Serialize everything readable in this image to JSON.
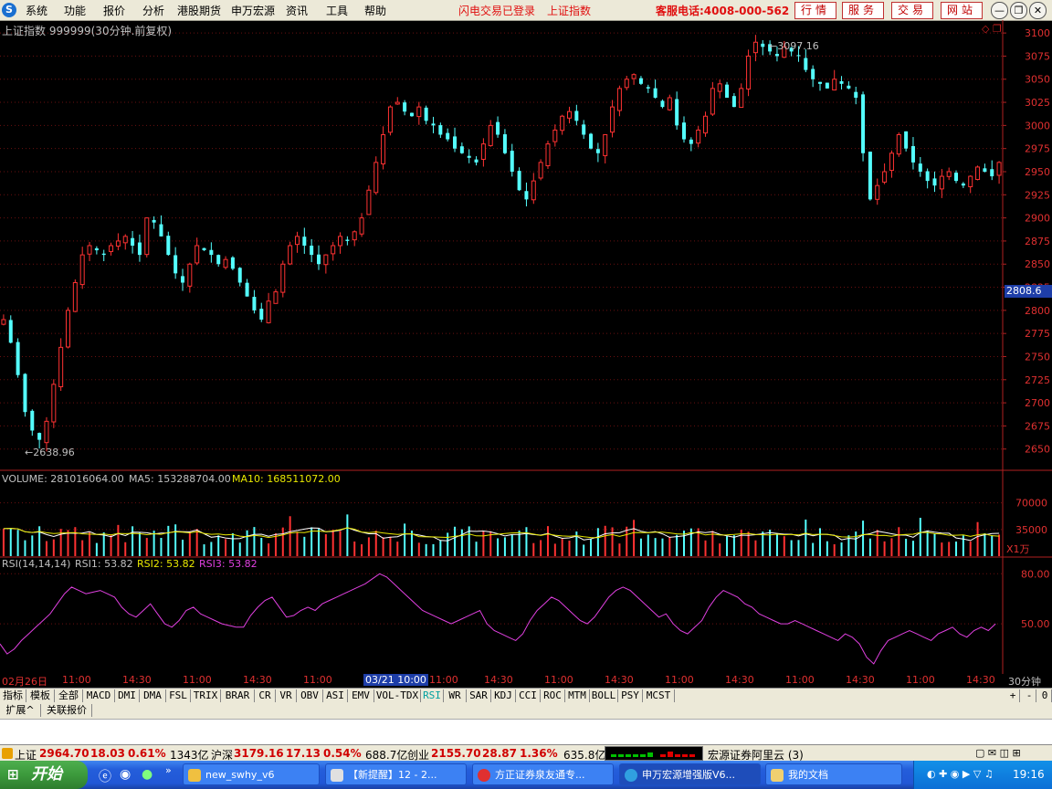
{
  "menubar": {
    "items": [
      "系统",
      "功能",
      "报价",
      "分析",
      "港股期货",
      "申万宏源",
      "资讯",
      "工具",
      "帮助"
    ],
    "login_status": "闪电交易已登录",
    "current_index": "上证指数",
    "hotline": "客服电话:4008-000-562",
    "service_buttons": [
      "行情",
      "服务",
      "交易",
      "网站"
    ],
    "window_controls": [
      "minimize",
      "restore",
      "close"
    ]
  },
  "chart_header": {
    "title": "上证指数 999999(30分钟.前复权)",
    "volume_label": "VOLUME: 281016064.00",
    "ma5_label": "MA5: 153288704.00",
    "ma10_label": "MA10: 168511072.00",
    "rsi_label": "RSI(14,14,14)",
    "rsi1_label": "RSI1: 53.82",
    "rsi2_label": "RSI2: 53.82",
    "rsi3_label": "RSI3: 53.82",
    "high_marker": "3097.16",
    "low_marker": "2638.96",
    "current_price_tag": "2808.6",
    "volume_unit": "X1万"
  },
  "chart_data": {
    "type": "candlestick",
    "price_axis_ticks": [
      "3100",
      "3075",
      "3050",
      "3025",
      "3000",
      "2975",
      "2950",
      "2925",
      "2900",
      "2875",
      "2850",
      "2825",
      "2800",
      "2775",
      "2750",
      "2725",
      "2700",
      "2675",
      "2650"
    ],
    "ylim": [
      2628,
      3110
    ],
    "volume_axis_ticks": [
      "70000",
      "35000"
    ],
    "rsi_axis_ticks": [
      "80.00",
      "50.00"
    ],
    "x_tick_labels": [
      "02月26日",
      "11:00",
      "14:30",
      "11:00",
      "14:30",
      "11:00",
      "03/21 10:00",
      "11:00",
      "14:30",
      "11:00",
      "14:30",
      "11:00",
      "14:30",
      "11:00",
      "14:30",
      "11:00",
      "14:30"
    ],
    "period_label": "30分钟",
    "series": [
      {
        "name": "close",
        "values": [
          2790,
          2765,
          2730,
          2690,
          2670,
          2660,
          2680,
          2720,
          2760,
          2800,
          2830,
          2860,
          2870,
          2865,
          2860,
          2870,
          2875,
          2880,
          2870,
          2860,
          2900,
          2895,
          2880,
          2860,
          2840,
          2830,
          2850,
          2870,
          2865,
          2860,
          2850,
          2855,
          2845,
          2830,
          2815,
          2800,
          2790,
          2810,
          2820,
          2850,
          2870,
          2880,
          2870,
          2860,
          2850,
          2860,
          2870,
          2880,
          2875,
          2885,
          2900,
          2930,
          2960,
          2990,
          3020,
          3025,
          3015,
          3010,
          3020,
          3005,
          3000,
          2990,
          2985,
          2975,
          2970,
          2965,
          2960,
          2980,
          3000,
          2990,
          2970,
          2950,
          2930,
          2920,
          2940,
          2960,
          2980,
          2995,
          3010,
          3015,
          3005,
          2990,
          2975,
          2970,
          2990,
          3020,
          3040,
          3050,
          3055,
          3045,
          3040,
          3030,
          3020,
          3030,
          3000,
          2985,
          2980,
          2995,
          3010,
          3040,
          3045,
          3030,
          3020,
          3040,
          3075,
          3090,
          3085,
          3080,
          3075,
          3085,
          3080,
          3075,
          3060,
          3050,
          3045,
          3040,
          3050,
          3045,
          3040,
          3030,
          2970,
          2920,
          2935,
          2950,
          2970,
          2990,
          2975,
          2960,
          2950,
          2940,
          2935,
          2945,
          2950,
          2940,
          2935,
          2945,
          2955,
          2950,
          2945,
          2960
        ]
      },
      {
        "name": "volume_scale_max",
        "values": [
          90000
        ]
      },
      {
        "name": "rsi",
        "values": [
          38,
          32,
          35,
          40,
          44,
          48,
          52,
          56,
          62,
          68,
          72,
          70,
          68,
          69,
          70,
          68,
          66,
          60,
          56,
          54,
          58,
          62,
          56,
          50,
          48,
          52,
          58,
          60,
          56,
          54,
          52,
          50,
          49,
          48,
          48,
          55,
          60,
          64,
          66,
          60,
          54,
          55,
          58,
          60,
          58,
          62,
          64,
          66,
          68,
          70,
          72,
          74,
          77,
          80,
          78,
          74,
          70,
          66,
          62,
          58,
          56,
          54,
          52,
          50,
          52,
          54,
          56,
          58,
          50,
          46,
          44,
          42,
          40,
          44,
          52,
          58,
          62,
          66,
          64,
          60,
          56,
          52,
          50,
          54,
          60,
          66,
          70,
          72,
          70,
          66,
          62,
          58,
          54,
          56,
          50,
          46,
          44,
          48,
          52,
          60,
          66,
          70,
          68,
          66,
          62,
          60,
          56,
          54,
          52,
          50,
          50,
          52,
          50,
          48,
          46,
          44,
          42,
          40,
          44,
          42,
          38,
          30,
          26,
          34,
          40,
          42,
          44,
          46,
          44,
          42,
          40,
          44,
          46,
          48,
          44,
          42,
          46,
          48,
          46,
          50
        ]
      }
    ]
  },
  "tabs": [
    "指标",
    "模板",
    "全部",
    "MACD",
    "DMI",
    "DMA",
    "FSL",
    "TRIX",
    "BRAR",
    "CR",
    "VR",
    "OBV",
    "ASI",
    "EMV",
    "VOL-TDX",
    "RSI",
    "WR",
    "SAR",
    "KDJ",
    "CCI",
    "ROC",
    "MTM",
    "BOLL",
    "PSY",
    "MCST"
  ],
  "active_tab": "RSI",
  "tab_controls": [
    "+",
    "-",
    "0"
  ],
  "subtabs": [
    "扩展^",
    "关联报价"
  ],
  "statusbar": {
    "sh_label": "上证",
    "sh_value": "2964.70",
    "sh_change": "18.03",
    "sh_pct": "0.61%",
    "sh_amount": "1343亿",
    "hs_label": "沪深",
    "hs_value": "3179.16",
    "hs_change": "17.13",
    "hs_pct": "0.54%",
    "hs_amount": "688.7亿",
    "cy_label": "创业",
    "cy_value": "2155.70",
    "cy_change": "28.87",
    "cy_pct": "1.36%",
    "cy_amount": "635.8亿",
    "server": "宏源证券阿里云 (3)"
  },
  "taskbar": {
    "start_label": "开始",
    "buttons": [
      "new_swhy_v6",
      "【新提醒】12 - 2...",
      "方正证券泉友通专...",
      "申万宏源增强版V6...",
      "我的文档"
    ],
    "clock": "19:16"
  }
}
